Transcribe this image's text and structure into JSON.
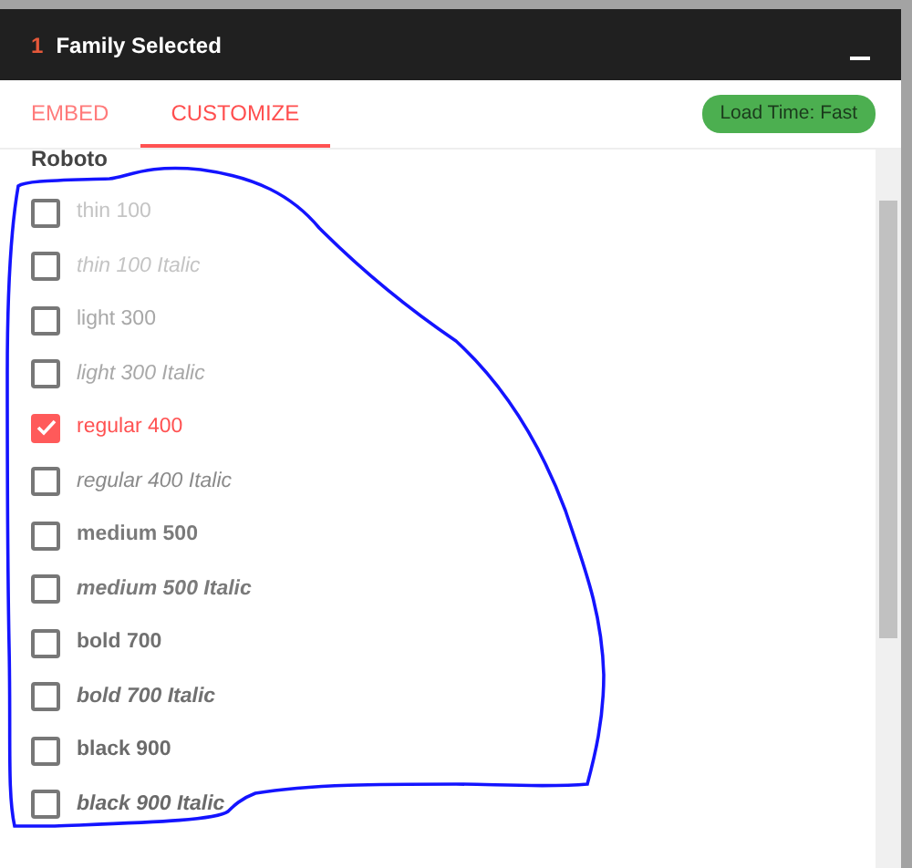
{
  "header": {
    "count": "1",
    "title": "Family Selected"
  },
  "tabs": [
    {
      "label": "EMBED",
      "selected": false
    },
    {
      "label": "CUSTOMIZE",
      "selected": true
    }
  ],
  "badge": "Load Time: Fast",
  "family": "Roboto",
  "styles": [
    {
      "label": "thin 100",
      "checked": false
    },
    {
      "label": "thin 100 Italic",
      "checked": false
    },
    {
      "label": "light 300",
      "checked": false
    },
    {
      "label": "light 300 Italic",
      "checked": false
    },
    {
      "label": "regular 400",
      "checked": true
    },
    {
      "label": "regular 400 Italic",
      "checked": false
    },
    {
      "label": "medium 500",
      "checked": false
    },
    {
      "label": "medium 500 Italic",
      "checked": false
    },
    {
      "label": "bold 700",
      "checked": false
    },
    {
      "label": "bold 700 Italic",
      "checked": false
    },
    {
      "label": "black 900",
      "checked": false
    },
    {
      "label": "black 900 Italic",
      "checked": false
    }
  ],
  "annotation": {
    "kind": "outline"
  }
}
